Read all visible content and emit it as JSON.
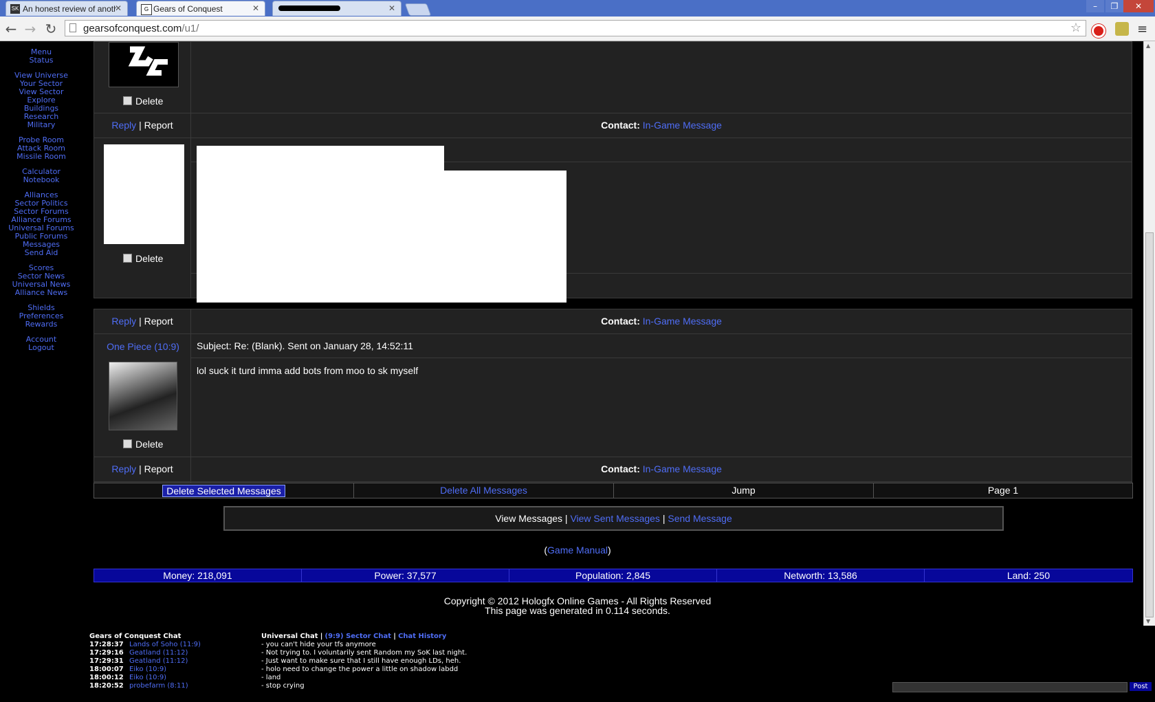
{
  "browser": {
    "tabs": [
      {
        "title": "An honest review of anoth",
        "icon": "sk-favicon",
        "active": false
      },
      {
        "title": "Gears of Conquest",
        "icon": "goc-favicon",
        "active": true
      },
      {
        "title": "",
        "icon": "redacted",
        "active": false
      }
    ],
    "url_host": "gearsofconquest.com",
    "url_path": "/u1/"
  },
  "nav": {
    "groups": [
      [
        "Menu",
        "Status"
      ],
      [
        "View Universe",
        "Your Sector",
        "View Sector",
        "Explore",
        "Buildings",
        "Research",
        "Military"
      ],
      [
        "Probe Room",
        "Attack Room",
        "Missile Room"
      ],
      [
        "Calculator",
        "Notebook"
      ],
      [
        "Alliances",
        "Sector Politics",
        "Sector Forums",
        "Alliance Forums",
        "Universal Forums",
        "Public Forums",
        "Messages",
        "Send Aid"
      ],
      [
        "Scores",
        "Sector News",
        "Universal News",
        "Alliance News"
      ],
      [
        "Shields",
        "Preferences",
        "Rewards"
      ],
      [
        "Account",
        "Logout"
      ]
    ]
  },
  "messages": {
    "delete_label": "Delete",
    "reply_label": "Reply",
    "separator": "|",
    "report_label": "Report",
    "contact_label": "Contact:",
    "contact_link": "In-Game Message",
    "third": {
      "sender": "One Piece (10:9)",
      "subject": "Subject: Re: (Blank). Sent on January 28, 14:52:11",
      "body": "lol suck it turd imma add bots from moo to sk myself"
    }
  },
  "actions": {
    "delete_selected": "Delete Selected Messages",
    "delete_all": "Delete All Messages",
    "jump": "Jump",
    "page": "Page 1"
  },
  "view_links": {
    "view": "View Messages",
    "sep": "|",
    "sent": "View Sent Messages",
    "send": "Send Message"
  },
  "manual": {
    "open": "(",
    "link": "Game Manual",
    "close": ")"
  },
  "stats": {
    "money": "Money: 218,091",
    "power": "Power: 37,577",
    "population": "Population: 2,845",
    "networth": "Networth: 13,586",
    "land": "Land: 250"
  },
  "copyright": {
    "line1": "Copyright © 2012 Hologfx Online Games - All Rights Reserved",
    "line2": "This page was generated in 0.114 seconds."
  },
  "chat": {
    "title": "Gears of Conquest Chat",
    "entries": [
      {
        "time": "17:28:37",
        "who": "Lands of Soho (11:9)"
      },
      {
        "time": "17:29:16",
        "who": "Geatland (11:12)"
      },
      {
        "time": "17:29:31",
        "who": "Geatland (11:12)"
      },
      {
        "time": "18:00:07",
        "who": "Eiko (10:9)"
      },
      {
        "time": "18:00:12",
        "who": "Eiko (10:9)"
      },
      {
        "time": "18:20:52",
        "who": "probefarm (8:11)"
      }
    ],
    "header_main": "Universal Chat",
    "header_sep": "|",
    "header_sector": "(9:9) Sector Chat",
    "header_sep2": "|",
    "header_history": "Chat History",
    "lines": [
      "- you can't hide your tfs anymore",
      "- Not trying to. I voluntarily sent Random my SoK last night.",
      "- Just want to make sure that I still have enough LDs, heh.",
      "- holo need to change the power a little on shadow labdd",
      "- land",
      "- stop crying"
    ],
    "post_label": "Post"
  },
  "colors": {
    "link": "#4f6df5",
    "stats_bg": "#07079a",
    "panel_bg": "#222222"
  }
}
